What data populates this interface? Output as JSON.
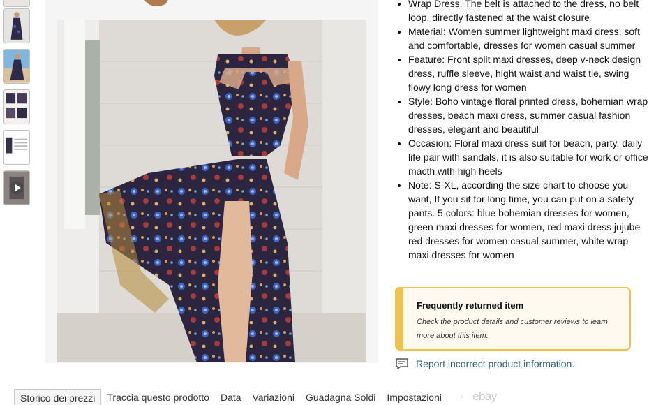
{
  "thumbnails": [
    {
      "name": "thumb-dress-partial",
      "kind": "photo"
    },
    {
      "name": "thumb-dress-full",
      "kind": "photo"
    },
    {
      "name": "thumb-dress-beach",
      "kind": "photo"
    },
    {
      "name": "thumb-dress-details",
      "kind": "photo"
    },
    {
      "name": "thumb-size-chart",
      "kind": "photo"
    },
    {
      "name": "thumb-video",
      "kind": "video",
      "icon": "play-icon"
    }
  ],
  "bullets": [
    "Wrap Dress. The belt is attached to the dress, no belt loop, directly fastened at the waist closure",
    "Material: Women summer lightweight maxi dress, soft and comfortable, dresses for women casual summer",
    "Feature: Front split maxi dresses, deep v-neck design dress, ruffle sleeve, hight waist and waist tie, swing flowy long dress for women",
    "Style: Boho vintage floral printed dress, bohemian wrap dresses, beach maxi dress, summer casual fashion dresses, elegant and beautiful",
    "Occasion: Floral maxi dress suit for beach, party, daily life pair with sandals, it is also suitable for work or office macth with high heels",
    "Note: S-XL, according the size chart to choose you want, If you sit for long time, you can put on a safety pants. 5 colors: blue bohemian dresses for women, green maxi dresses for women, red maxi dress jujube red dresses for women casual summer, white wrap maxi dresses for women"
  ],
  "returned": {
    "title": "Frequently returned item",
    "desc": "Check the product details and customer reviews to learn more about this item.",
    "accent": "#f0c14b"
  },
  "report": {
    "label": "Report incorrect product information.",
    "icon": "feedback-icon",
    "color": "#2a5e7f"
  },
  "tabs": [
    {
      "label": "Storico dei prezzi",
      "active": true
    },
    {
      "label": "Traccia questo prodotto",
      "active": false
    },
    {
      "label": "Data",
      "active": false
    },
    {
      "label": "Variazioni",
      "active": false
    },
    {
      "label": "Guadagna Soldi",
      "active": false
    },
    {
      "label": "Impostazioni",
      "active": false
    }
  ],
  "tab_arrow": "→",
  "ebay_label": "ebay"
}
